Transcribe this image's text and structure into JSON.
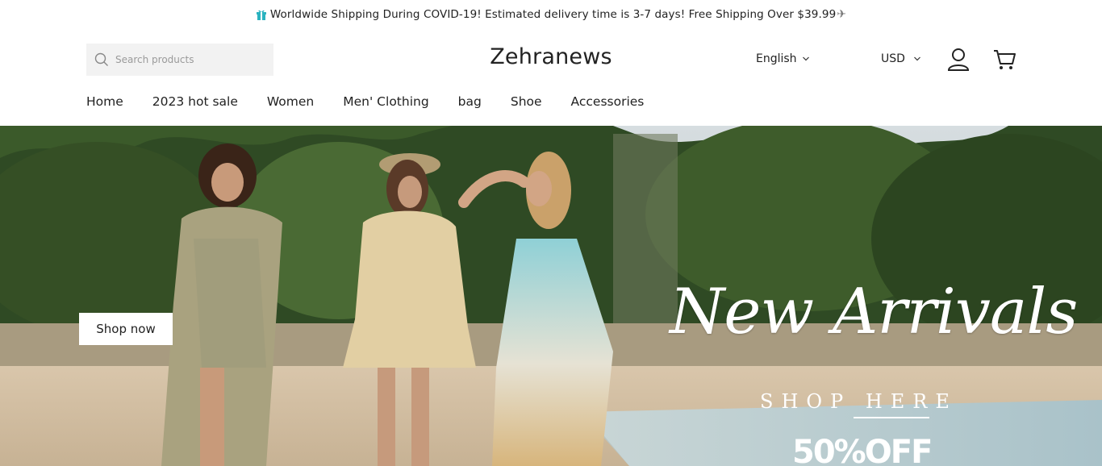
{
  "announcement": {
    "text": "Worldwide Shipping During COVID-19! Estimated delivery time is 3-7 days!  Free Shipping Over $39.99",
    "plane_glyph": "✈"
  },
  "header": {
    "search_placeholder": "Search products",
    "brand": "Zehranews",
    "language": "English",
    "currency": "USD"
  },
  "nav": {
    "items": [
      "Home",
      "2023 hot sale",
      "Women",
      "Men' Clothing",
      "bag",
      "Shoe",
      "Accessories"
    ]
  },
  "hero": {
    "button_label": "Shop now",
    "headline": "New Arrivals",
    "subheadline": "SHOP HERE",
    "promo": "50%OFF"
  },
  "colors": {
    "accent_icon": "#2bb3c0",
    "text": "#222222",
    "search_bg": "#f2f2f2"
  },
  "icons": {
    "gift": "gift-icon",
    "search": "search-icon",
    "chevron": "chevron-down-icon",
    "user": "user-icon",
    "cart": "cart-icon",
    "plane": "airplane-icon"
  }
}
